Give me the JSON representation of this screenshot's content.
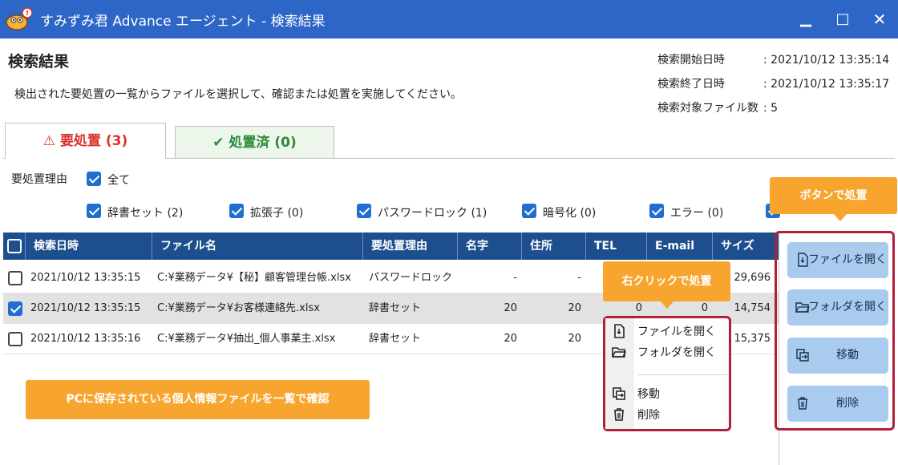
{
  "window": {
    "title": "すみずみ君 Advance エージェント - 検索結果",
    "controls": {
      "minimize": "▁",
      "maximize": "□",
      "close": "✕"
    }
  },
  "header": {
    "section_title": "検索結果",
    "description": "検出された要処置の一覧からファイルを選択して、確認または処置を実施してください。",
    "meta": [
      {
        "label": "検索開始日時",
        "value": ": 2021/10/12 13:35:14"
      },
      {
        "label": "検索終了日時",
        "value": ": 2021/10/12 13:35:17"
      },
      {
        "label": "検索対象ファイル数",
        "value": ": 5"
      }
    ]
  },
  "tabs": [
    {
      "icon": "⚠",
      "label": "要処置 (3)"
    },
    {
      "icon": "✔",
      "label": "処置済 (0)"
    }
  ],
  "filters": {
    "label": "要処置理由",
    "all": "全て",
    "items": [
      "辞書セット (2)",
      "拡張子 (0)",
      "パスワードロック (1)",
      "暗号化 (0)",
      "エラー (0)"
    ]
  },
  "table": {
    "headers": [
      "検索日時",
      "ファイル名",
      "要処置理由",
      "名字",
      "住所",
      "TEL",
      "E-mail",
      "サイズ"
    ],
    "rows": [
      {
        "checked": false,
        "date": "2021/10/12 13:35:15",
        "file": "C:¥業務データ¥【秘】顧客管理台帳.xlsx",
        "reason": "パスワードロック",
        "surname": "-",
        "address": "-",
        "tel": "",
        "email": "",
        "size": "29,696"
      },
      {
        "checked": true,
        "date": "2021/10/12 13:35:15",
        "file": "C:¥業務データ¥お客様連絡先.xlsx",
        "reason": "辞書セット",
        "surname": "20",
        "address": "20",
        "tel": "0",
        "email": "0",
        "size": "14,754"
      },
      {
        "checked": false,
        "date": "2021/10/12 13:35:16",
        "file": "C:¥業務データ¥抽出_個人事業主.xlsx",
        "reason": "辞書セット",
        "surname": "20",
        "address": "20",
        "tel": "",
        "email": "",
        "size": "15,375"
      }
    ]
  },
  "side_buttons": [
    {
      "icon": "file-open-icon",
      "label": "ファイルを開く"
    },
    {
      "icon": "folder-open-icon",
      "label": "フォルダを開く"
    },
    {
      "icon": "move-icon",
      "label": "移動"
    },
    {
      "icon": "trash-icon",
      "label": "削除"
    }
  ],
  "context_menu": [
    {
      "icon": "file-open-icon",
      "label": "ファイルを開く"
    },
    {
      "icon": "folder-open-icon",
      "label": "フォルダを開く"
    },
    {
      "icon": "move-icon",
      "label": "移動"
    },
    {
      "icon": "trash-icon",
      "label": "削除"
    }
  ],
  "callouts": {
    "buttons": "ボタンで処置",
    "right_click": "右クリックで処置",
    "pc_files": "PCに保存されている個人情報ファイルを一覧で確認"
  },
  "colors": {
    "titlebar": "#2e66c8",
    "table_header": "#1d4f8f",
    "accent_orange": "#f7a52e",
    "highlight_red": "#b31f3b",
    "alert_red": "#d9342b",
    "done_green": "#2e8a3a",
    "checkbox_blue": "#1f6fd0",
    "side_button": "#a9cbee"
  }
}
